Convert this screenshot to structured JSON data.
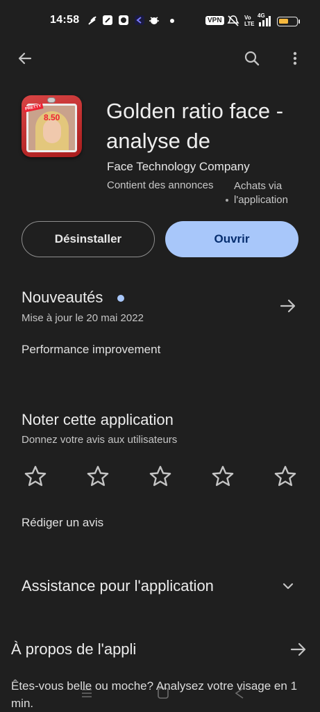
{
  "status_bar": {
    "time": "14:58",
    "vpn_label": "VPN",
    "network_label": "4G",
    "volte_label": "Vo LTE",
    "battery_level": 0.55,
    "battery_color": "#f5b73d",
    "icons": [
      "feather-icon",
      "notes-icon",
      "app-icon",
      "arrow-icon",
      "bug-icon",
      "dot-icon",
      "mute-icon",
      "signal-icon",
      "battery-icon"
    ]
  },
  "toolbar": {
    "back_icon": "back-arrow-icon",
    "search_icon": "search-icon",
    "more_icon": "more-vert-icon"
  },
  "app": {
    "title": "Golden ratio face - analyse de",
    "developer": "Face Technology Company",
    "ads_label": "Contient des annonces",
    "iap_label": "Achats via l'application",
    "icon_score": "8.50",
    "icon_badge": "PRETTY",
    "uninstall_label": "Désinstaller",
    "open_label": "Ouvrir",
    "accent_color": "#a8c7fa"
  },
  "whats_new": {
    "title": "Nouveautés",
    "updated": "Mise à jour le 20 mai 2022",
    "notes": "Performance improvement"
  },
  "rate": {
    "title": "Noter cette application",
    "subtitle": "Donnez votre avis aux utilisateurs",
    "stars": 5,
    "rating": 0,
    "write_review": "Rédiger un avis"
  },
  "support": {
    "title": "Assistance pour l'application"
  },
  "about": {
    "title": "À propos de l'appli",
    "description": "Êtes-vous belle ou moche? Analysez votre visage en 1 min."
  }
}
